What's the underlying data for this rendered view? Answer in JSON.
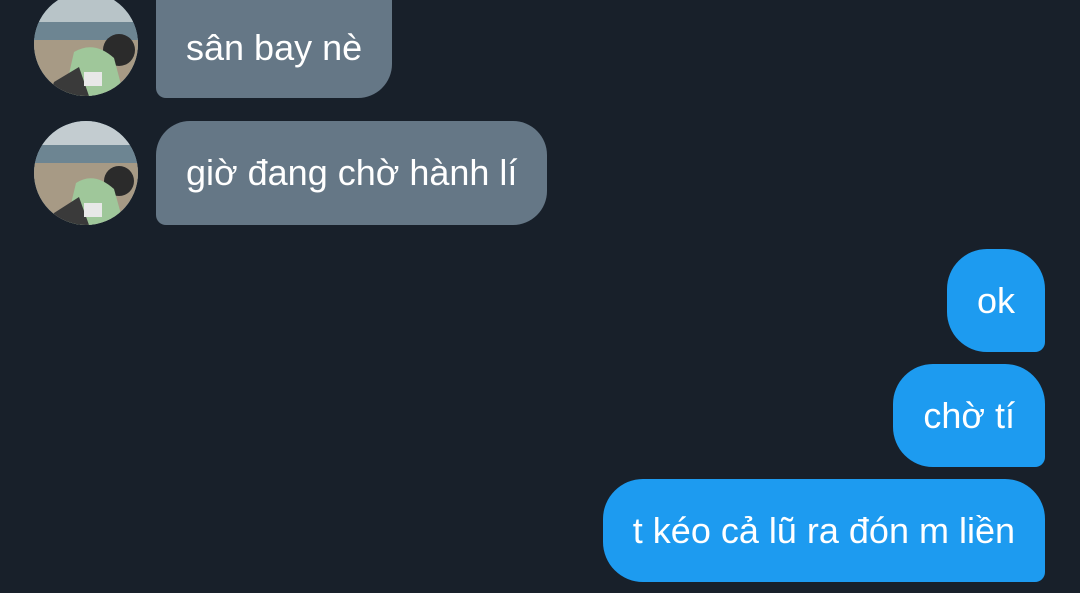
{
  "conversation": {
    "incoming": [
      {
        "text": "sân bay nè",
        "avatar_icon": "contact-avatar-photo"
      },
      {
        "text": "giờ đang chờ hành lí",
        "avatar_icon": "contact-avatar-photo"
      }
    ],
    "outgoing": [
      {
        "text": "ok"
      },
      {
        "text": "chờ tí"
      },
      {
        "text": "t kéo cả lũ ra đón m liền"
      }
    ]
  },
  "colors": {
    "background": "#18202a",
    "incoming_bubble": "#657786",
    "outgoing_bubble": "#1d9bf0",
    "text": "#ffffff"
  }
}
